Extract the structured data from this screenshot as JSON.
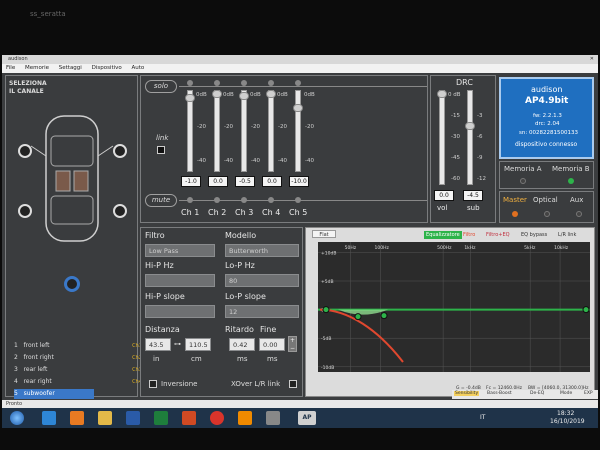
{
  "window": {
    "title": "audison",
    "desktop_label": "ss_seratta"
  },
  "menu": [
    "File",
    "Memorie",
    "Settaggi",
    "Dispositivo",
    "Auto"
  ],
  "channel_select": {
    "title_line1": "SELEZIONA",
    "title_line2": "IL CANALE",
    "items": [
      {
        "num": "1",
        "label": "front left",
        "tag": "Ch1"
      },
      {
        "num": "2",
        "label": "front right",
        "tag": "Ch2"
      },
      {
        "num": "3",
        "label": "rear left",
        "tag": "Ch3"
      },
      {
        "num": "4",
        "label": "rear right",
        "tag": "Ch4"
      },
      {
        "num": "5",
        "label": "subwoofer",
        "tag": "Ch5"
      }
    ]
  },
  "mixer": {
    "solo_label": "solo",
    "mute_label": "mute",
    "link_label": "link",
    "scale": [
      "0dB",
      "-20",
      "-40"
    ],
    "channels": [
      {
        "name": "Ch 1",
        "value": "-1.0"
      },
      {
        "name": "Ch 2",
        "value": "0.0"
      },
      {
        "name": "Ch 3",
        "value": "-0.5"
      },
      {
        "name": "Ch 4",
        "value": "0.0"
      },
      {
        "name": "Ch 5",
        "value": "-10.0"
      }
    ]
  },
  "drc": {
    "title": "DRC",
    "vol_scale": [
      "0 dB",
      "-15",
      "-30",
      "-45",
      "-60"
    ],
    "sub_scale": [
      "0 dB",
      "-3",
      "-6",
      "-9",
      "-12"
    ],
    "vol_value": "0.0",
    "sub_value": "-4.5",
    "vol_label": "vol",
    "sub_label": "sub"
  },
  "device": {
    "brand": "audison",
    "model": "AP4.9bit",
    "fw": "fw: 2.2.1.3",
    "drc": "drc: 2.04",
    "sn": "sn: 00282281500133",
    "status": "dispositivo connesso"
  },
  "memory": {
    "a": "Memoria A",
    "b": "Memoria B"
  },
  "inputs": {
    "master": "Master",
    "optical": "Optical",
    "aux": "Aux"
  },
  "filter": {
    "filtro_label": "Filtro",
    "filtro_value": "Low Pass",
    "modello_label": "Modello",
    "modello_value": "Butterworth",
    "hip_hz_label": "Hi-P Hz",
    "hip_hz_value": "",
    "lop_hz_label": "Lo-P Hz",
    "lop_hz_value": "80",
    "hip_slope_label": "Hi-P slope",
    "hip_slope_value": "",
    "lop_slope_label": "Lo-P slope",
    "lop_slope_value": "12",
    "distanza_label": "Distanza",
    "in_value": "43.5",
    "cm_value": "110.5",
    "in_label": "in",
    "cm_label": "cm",
    "ritardo_label": "Ritardo",
    "fine_label": "Fine",
    "ms_value": "0.42",
    "fine_value": "0.00",
    "ms_label": "ms",
    "ms2_label": "ms",
    "inversione_label": "Inversione",
    "xover_label": "XOver L/R link"
  },
  "eq": {
    "flat_tab": "Flat",
    "equalizzatore": "Equalizzatore",
    "filtro": "Filtro",
    "filtro_eq": "Filtro+EQ",
    "eq_bypass": "EQ bypass",
    "lr_link": "L/R link",
    "freq_labels": [
      "50Hz",
      "100Hz",
      "500Hz",
      "1kHz",
      "5kHz",
      "10kHz"
    ],
    "db_labels": [
      "+10dB",
      "+5dB",
      "0dB",
      "-5dB",
      "-10dB"
    ],
    "readout_g": "G = -0.4dB",
    "readout_fc": "Fc = 12460.0Hz",
    "readout_bw": "BW = [4060.0, 31300.0]Hz",
    "mode_buttons": [
      "Sensibility",
      "Bass-Boost",
      "De-EQ",
      "Mode",
      "EXP"
    ]
  },
  "status_text": "Pronto",
  "taskbar": {
    "lang": "IT",
    "time": "18:32",
    "date": "16/10/2019"
  },
  "colors": {
    "accent": "#1f6fc0",
    "green": "#2db34a",
    "red": "#e0482f",
    "panel": "#3a3c3e"
  }
}
